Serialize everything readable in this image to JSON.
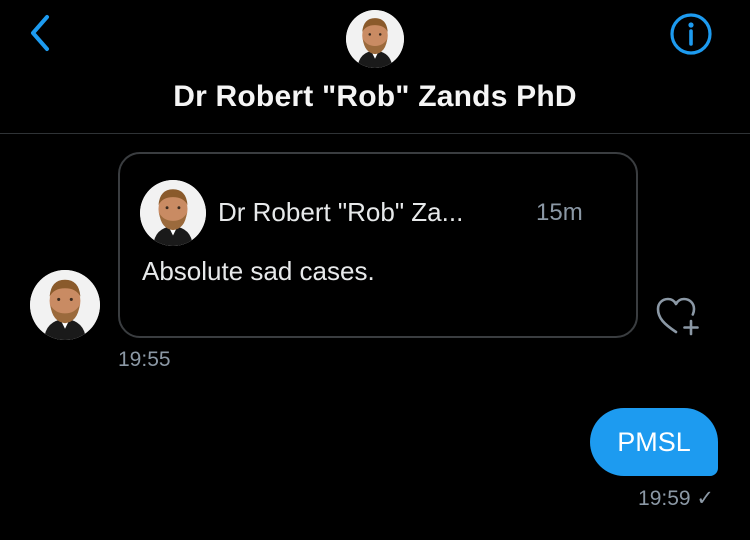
{
  "header": {
    "title": "Dr Robert \"Rob\" Zands PhD",
    "back_icon": "chevron-left-icon",
    "info_icon": "info-circle-icon"
  },
  "colors": {
    "accent": "#1d9bf0",
    "background": "#000000",
    "muted_text": "#8b98a5",
    "card_border": "#3a3d40"
  },
  "messages": {
    "incoming": {
      "quoted_author": "Dr Robert \"Rob\" Za...",
      "quoted_time": "15m",
      "quoted_text": "Absolute sad cases.",
      "timestamp": "19:55",
      "like_icon": "heart-plus-icon"
    },
    "outgoing": {
      "text": "PMSL",
      "timestamp": "19:59 ✓"
    }
  }
}
